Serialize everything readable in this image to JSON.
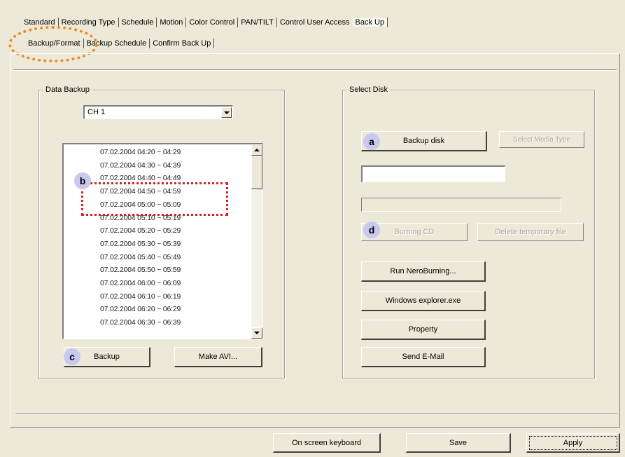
{
  "tabs_top": [
    "Standard",
    "Recording Type",
    "Schedule",
    "Motion",
    "Color Control",
    "PAN/TILT",
    "Control User Access",
    "Back Up"
  ],
  "tabs_sub": [
    "Backup/Format",
    "Backup Schedule",
    "Confirm Back Up"
  ],
  "data_backup": {
    "label": "Data Backup",
    "channel": "CH 1",
    "list": [
      "07.02.2004 04:20 ~ 04:29",
      "07.02.2004 04:30 ~ 04:39",
      "07.02.2004 04:40 ~ 04:49",
      "07.02.2004 04:50 ~ 04:59",
      "07.02.2004 05:00 ~ 05:09",
      "07.02.2004 05:10 ~ 05:19",
      "07.02.2004 05:20 ~ 05:29",
      "07.02.2004 05:30 ~ 05:39",
      "07.02.2004 05:40 ~ 05:49",
      "07.02.2004 05:50 ~ 05:59",
      "07.02.2004 06:00 ~ 06:09",
      "07.02.2004 06:10 ~ 06:19",
      "07.02.2004 06:20 ~ 06:29",
      "07.02.2004 06:30 ~ 06:39"
    ],
    "backup_btn": "Backup",
    "make_avi_btn": "Make AVI..."
  },
  "select_disk": {
    "label": "Select Disk",
    "backup_disk_btn": "Backup disk",
    "select_media_btn": "Select Media Type",
    "disk_field": "",
    "burning_cd_btn": "Burning CD",
    "delete_temp_btn": "Delete temporary file",
    "run_nero_btn": "Run NeroBurning...",
    "explorer_btn": "Windows explorer.exe",
    "property_btn": "Property",
    "email_btn": "Send E-Mail"
  },
  "bottom": {
    "keyboard_btn": "On screen keyboard",
    "save_btn": "Save",
    "apply_btn": "Apply"
  },
  "markers": {
    "a": "a",
    "b": "b",
    "c": "c",
    "d": "d"
  },
  "colors": {
    "dialog_bg": "#ece9d8",
    "marker_bg": "#c9c8f0",
    "highlight_red": "#d42020",
    "highlight_orange": "#f08a1e"
  }
}
